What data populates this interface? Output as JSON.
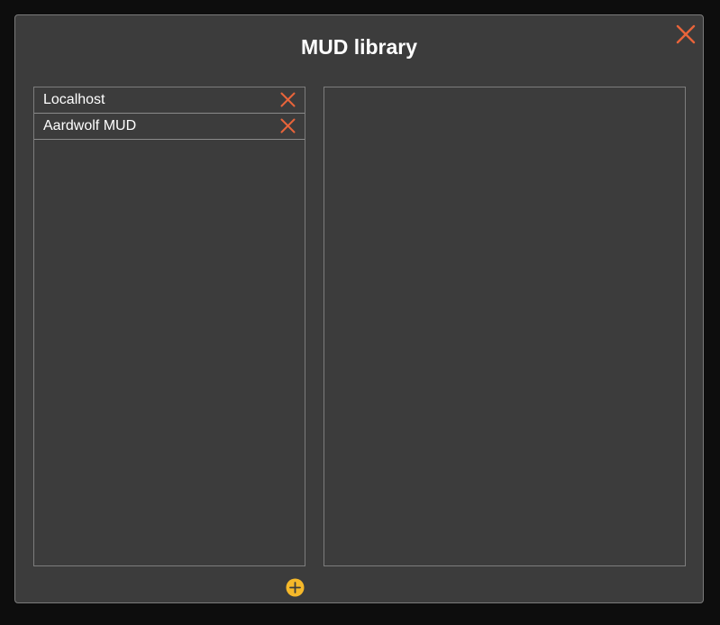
{
  "dialog": {
    "title": "MUD library",
    "close_icon": "close-icon",
    "accent_color": "#e8643a",
    "add_color": "#f5b82a"
  },
  "mud_list": {
    "items": [
      {
        "label": "Localhost",
        "remove_icon": "close-icon"
      },
      {
        "label": "Aardwolf MUD",
        "remove_icon": "close-icon"
      }
    ],
    "add_icon": "add-circle-icon"
  }
}
